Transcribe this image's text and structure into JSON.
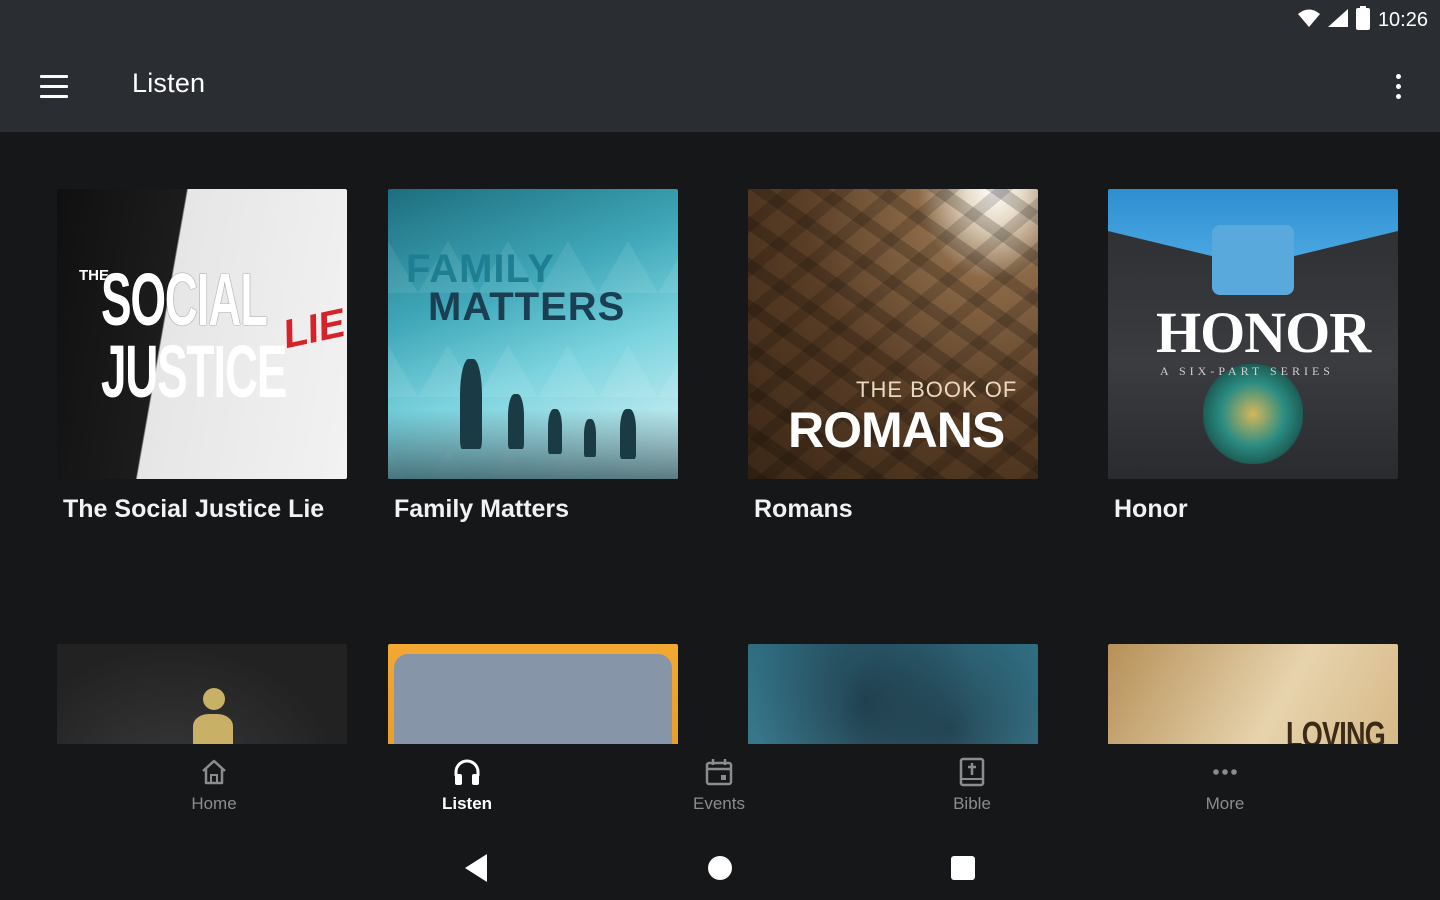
{
  "status_bar": {
    "time": "10:26",
    "icons": [
      "wifi-icon",
      "cell-signal-icon",
      "battery-icon"
    ]
  },
  "app_bar": {
    "title": "Listen",
    "icons": [
      "menu-icon",
      "overflow-menu-icon"
    ]
  },
  "series": [
    {
      "title": "The Social Justice Lie",
      "art": {
        "pre": "THE",
        "line1": "SOCIAL",
        "line2": "JUSTICE",
        "accent": "LIE"
      }
    },
    {
      "title": "Family Matters",
      "art": {
        "line1": "FAMILY",
        "line2": "MATTERS"
      }
    },
    {
      "title": "Romans",
      "art": {
        "line1": "THE BOOK OF",
        "line2": "ROMANS"
      }
    },
    {
      "title": "Honor",
      "art": {
        "line1": "HONOR",
        "line2": "A SIX-PART SERIES"
      }
    }
  ],
  "series_row2": [
    {
      "art_name": "series-art-5"
    },
    {
      "art_name": "series-art-6"
    },
    {
      "art_name": "series-art-7"
    },
    {
      "art_name": "series-art-8",
      "art_text": "LOVING"
    }
  ],
  "bottom_nav": {
    "items": [
      {
        "label": "Home",
        "icon": "home-icon",
        "active": false
      },
      {
        "label": "Listen",
        "icon": "headphones-icon",
        "active": true
      },
      {
        "label": "Events",
        "icon": "calendar-icon",
        "active": false
      },
      {
        "label": "Bible",
        "icon": "bible-icon",
        "active": false
      },
      {
        "label": "More",
        "icon": "more-horizontal-icon",
        "active": false
      }
    ]
  },
  "system_nav": {
    "icons": [
      "back-icon",
      "home-circle-icon",
      "recents-icon"
    ]
  },
  "colors": {
    "background": "#151719",
    "app_bar": "#2a2d31",
    "text_primary": "#ffffff",
    "text_inactive": "#8a8c8f",
    "accent_red": "#d8222a"
  }
}
